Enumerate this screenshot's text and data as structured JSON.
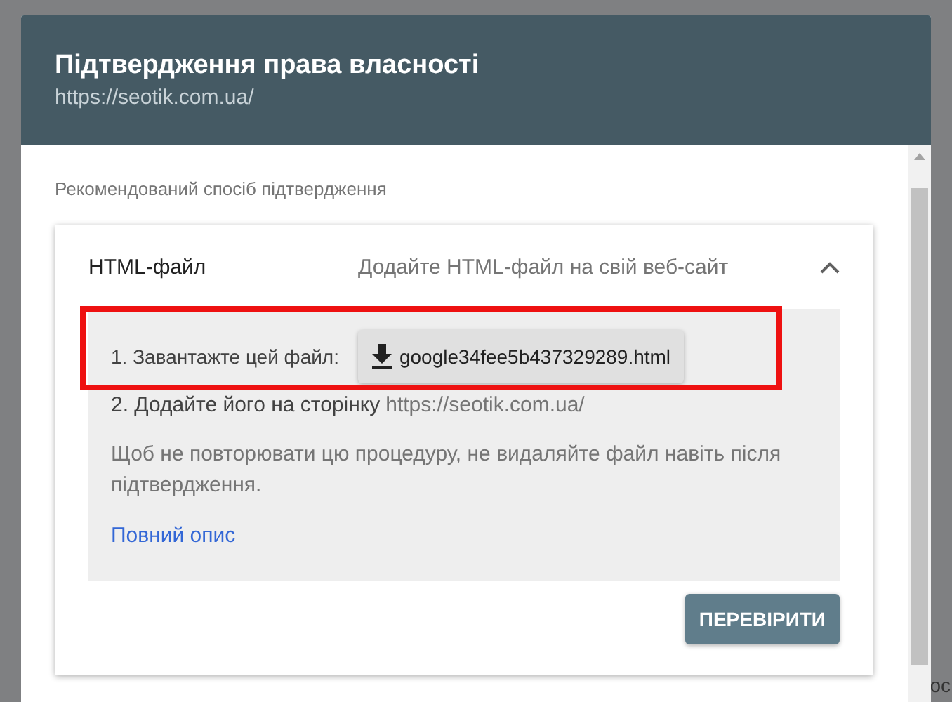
{
  "dialog": {
    "title": "Підтвердження права власності",
    "subtitle": "https://seotik.com.ua/"
  },
  "section_label": "Рекомендований спосіб підтвердження",
  "method": {
    "name": "HTML-файл",
    "description": "Додайте HTML-файл на свій веб-сайт",
    "expanded": true,
    "step_1": {
      "label": "1. Завантажте цей файл:",
      "file_button": "google34fee5b437329289.html",
      "highlighted": true
    },
    "step_2": {
      "label": "2. Додайте його на сторінку",
      "url": "https://seotik.com.ua/"
    },
    "note": "Щоб не повторювати цю процедуру, не видаляйте файл навіть після підтвердження.",
    "details_link": "Повний опис",
    "verify_button": "ПЕРЕВІРИТИ"
  },
  "background_text": "ос"
}
